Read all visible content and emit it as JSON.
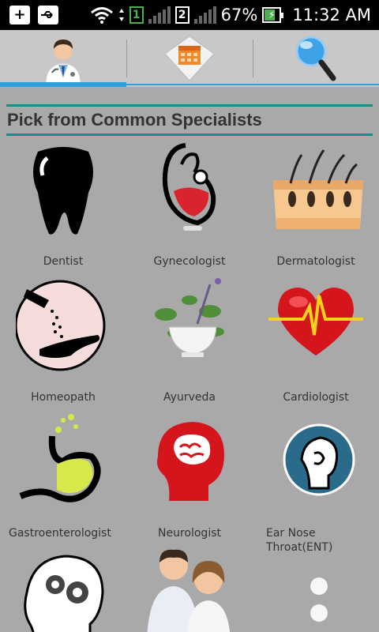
{
  "status_bar": {
    "battery": "67%",
    "time": "11:32 AM",
    "sim1": "1",
    "sim2": "2"
  },
  "tabs": [
    {
      "name": "doctor",
      "icon": "doctor-icon",
      "active": true
    },
    {
      "name": "calendar",
      "icon": "calendar-icon",
      "active": false
    },
    {
      "name": "search",
      "icon": "magnifier-icon",
      "active": false
    }
  ],
  "header": {
    "title": "Pick from Common Specialists"
  },
  "specialists": [
    {
      "label": "Dentist",
      "icon": "tooth-icon"
    },
    {
      "label": "Gynecologist",
      "icon": "mother-baby-icon"
    },
    {
      "label": "Dermatologist",
      "icon": "skin-layer-icon"
    },
    {
      "label": "Homeopath",
      "icon": "pills-hand-icon"
    },
    {
      "label": "Ayurveda",
      "icon": "mortar-herbs-icon"
    },
    {
      "label": "Cardiologist",
      "icon": "heart-ecg-icon"
    },
    {
      "label": "Gastroenterologist",
      "icon": "stomach-icon"
    },
    {
      "label": "Neurologist",
      "icon": "brain-head-icon"
    },
    {
      "label": "Ear Nose Throat(ENT)",
      "icon": "ent-head-icon"
    },
    {
      "label": "",
      "icon": "head-gears-icon"
    },
    {
      "label": "",
      "icon": "doctors-icon"
    },
    {
      "label": "",
      "icon": "dots-icon"
    }
  ],
  "colors": {
    "background": "#a9a9a9",
    "accent": "#31a0d8",
    "header_rule": "#1f8a84"
  }
}
